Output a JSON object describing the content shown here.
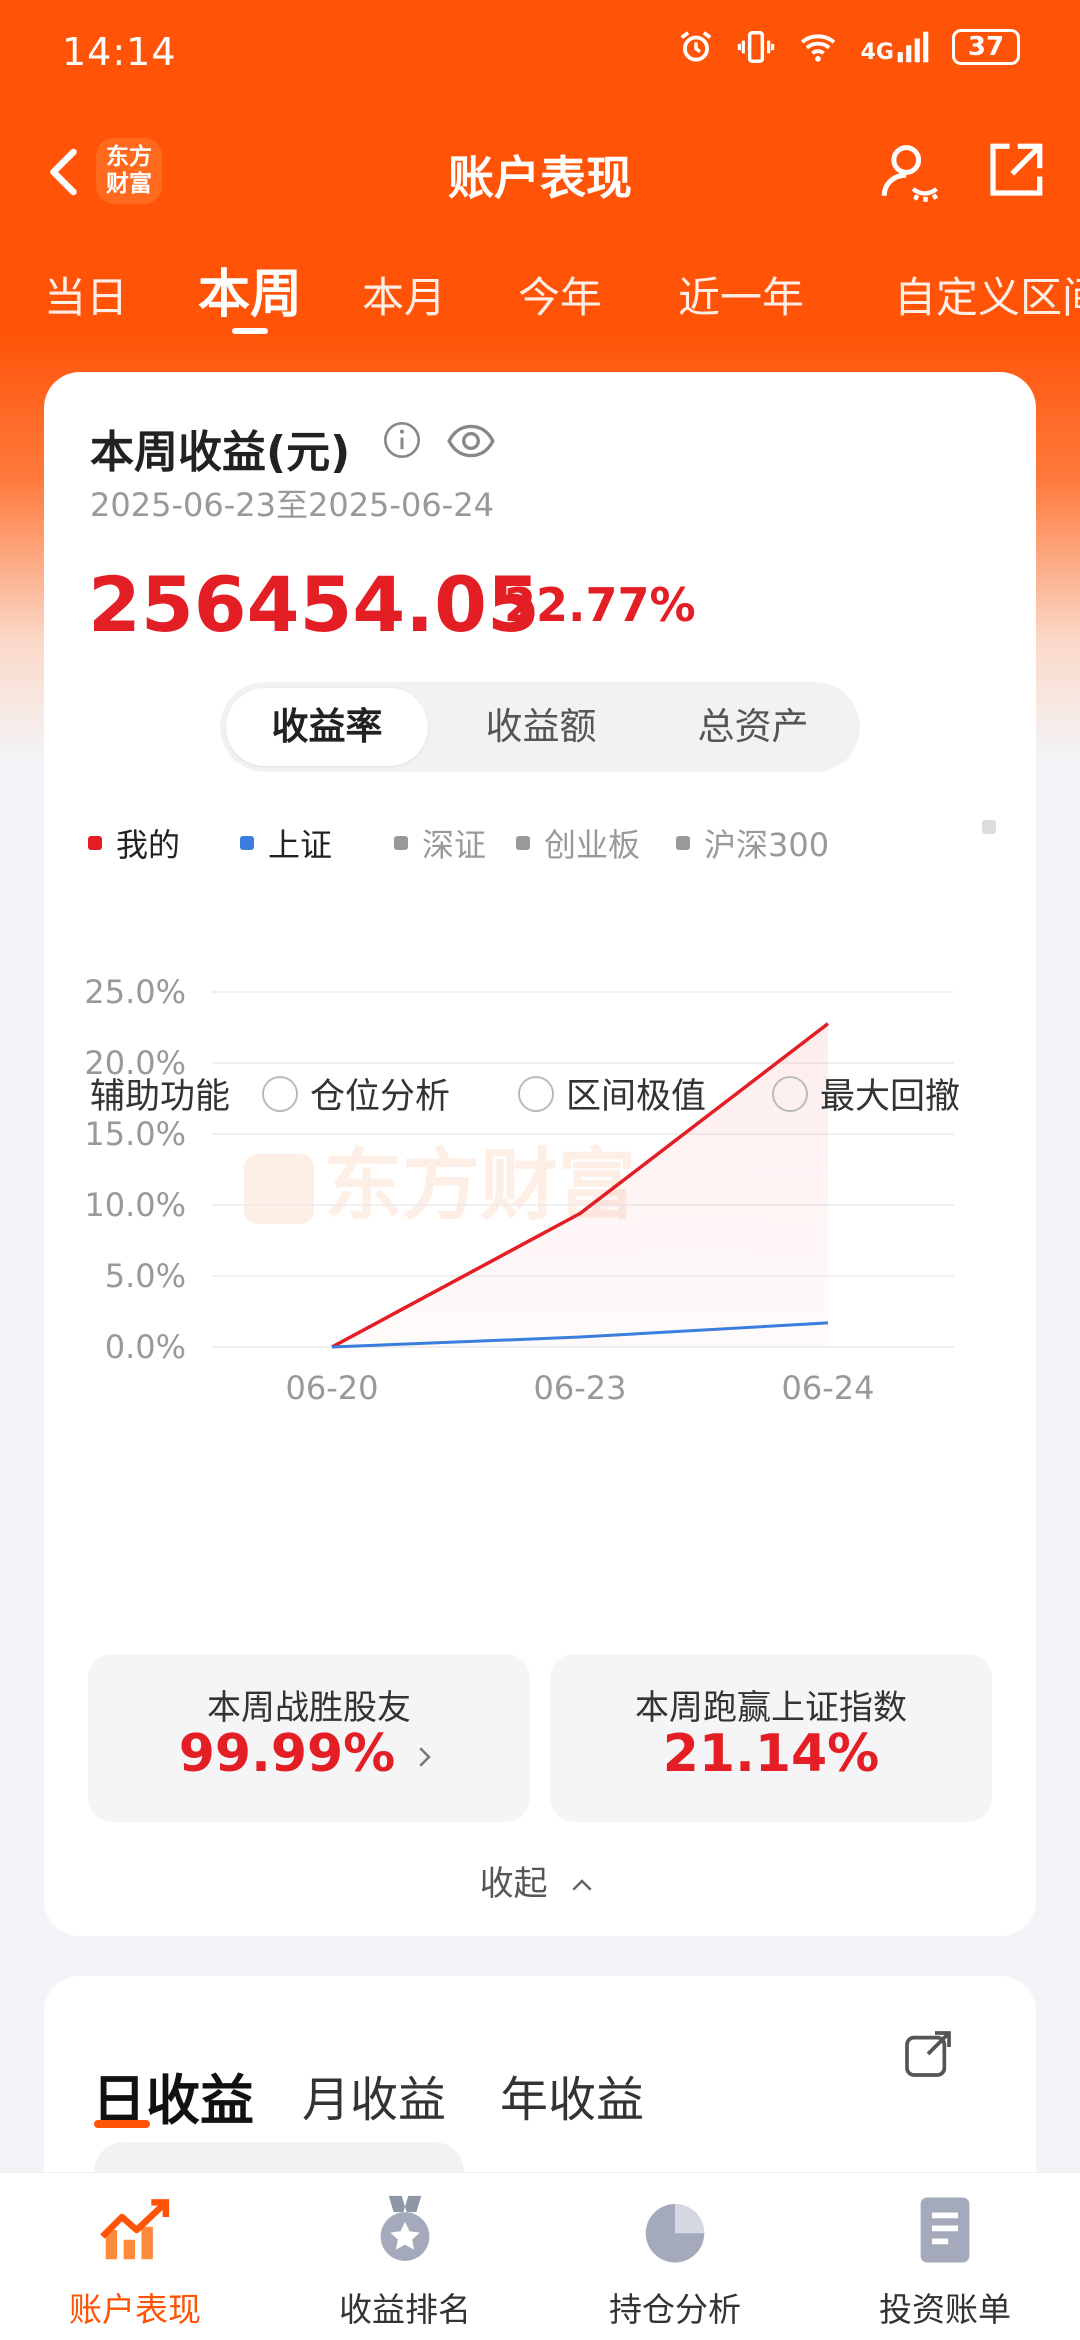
{
  "status_bar": {
    "time": "14:14",
    "network": "4G",
    "battery": "37"
  },
  "nav": {
    "title": "账户表现",
    "logo_text": "东方财富"
  },
  "period_tabs": [
    "当日",
    "本周",
    "本月",
    "今年",
    "近一年",
    "自定义区间"
  ],
  "summary": {
    "title": "本周收益(元)",
    "date_range": "2025-06-23至2025-06-24",
    "amount": "256454.05",
    "percent": "22.77%"
  },
  "segments": [
    "收益率",
    "收益额",
    "总资产"
  ],
  "legend": [
    {
      "label": "我的",
      "color": "#e31e24",
      "active": true
    },
    {
      "label": "上证",
      "color": "#3b7ddd",
      "active": true
    },
    {
      "label": "深证",
      "color": "#999999",
      "active": false
    },
    {
      "label": "创业板",
      "color": "#999999",
      "active": false
    },
    {
      "label": "沪深300",
      "color": "#999999",
      "active": false
    }
  ],
  "chart_data": {
    "type": "line",
    "x": [
      "06-20",
      "06-23",
      "06-24"
    ],
    "series": [
      {
        "name": "我的",
        "values": [
          0.0,
          9.4,
          22.77
        ],
        "color": "#e31e24"
      },
      {
        "name": "上证",
        "values": [
          0.0,
          0.7,
          1.7
        ],
        "color": "#3b7ddd"
      }
    ],
    "y_ticks": [
      "0.0%",
      "5.0%",
      "10.0%",
      "15.0%",
      "20.0%",
      "25.0%"
    ],
    "ylim": [
      0,
      25
    ],
    "grid": true,
    "watermark": "东方财富"
  },
  "aux": {
    "label": "辅助功能",
    "options": [
      "仓位分析",
      "区间极值",
      "最大回撤"
    ]
  },
  "stats": [
    {
      "title": "本周战胜股友",
      "value": "99.99%"
    },
    {
      "title": "本周跑赢上证指数",
      "value": "21.14%"
    }
  ],
  "collapse_label": "收起",
  "income_tabs": [
    "日收益",
    "月收益",
    "年收益"
  ],
  "bottom_nav": [
    "账户表现",
    "收益排名",
    "持仓分析",
    "投资账单"
  ]
}
